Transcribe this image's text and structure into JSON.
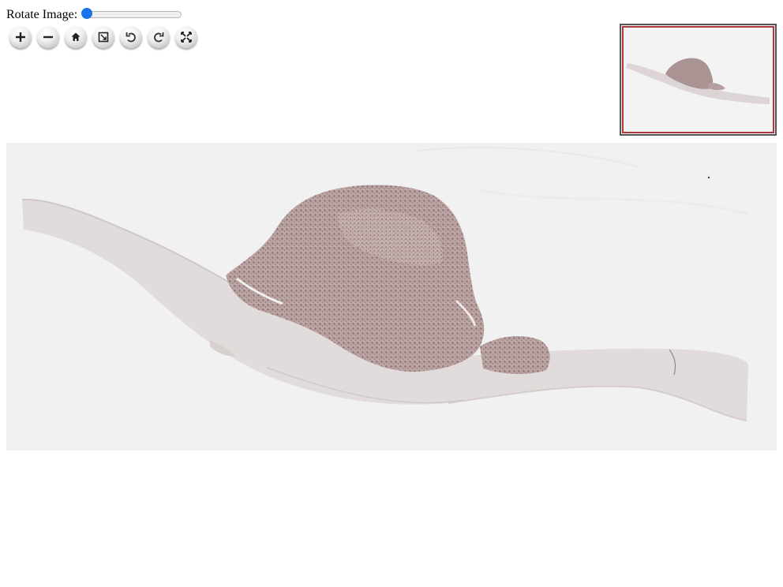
{
  "rotate": {
    "label": "Rotate Image:",
    "value": 0
  },
  "toolbar": {
    "buttons": [
      {
        "icon": "plus-icon",
        "action": "zoom-in"
      },
      {
        "icon": "minus-icon",
        "action": "zoom-out"
      },
      {
        "icon": "home-icon",
        "action": "home"
      },
      {
        "icon": "fullpage-icon",
        "action": "full-page"
      },
      {
        "icon": "rotate-left-icon",
        "action": "rotate-left"
      },
      {
        "icon": "rotate-right-icon",
        "action": "rotate-right"
      },
      {
        "icon": "flip-icon",
        "action": "flip"
      }
    ]
  },
  "colors": {
    "slider_thumb": "#1a73e8",
    "navigator_region": "#b03a3a",
    "viewer_background": "#f1f1f1",
    "tissue": "#a38c8c"
  }
}
